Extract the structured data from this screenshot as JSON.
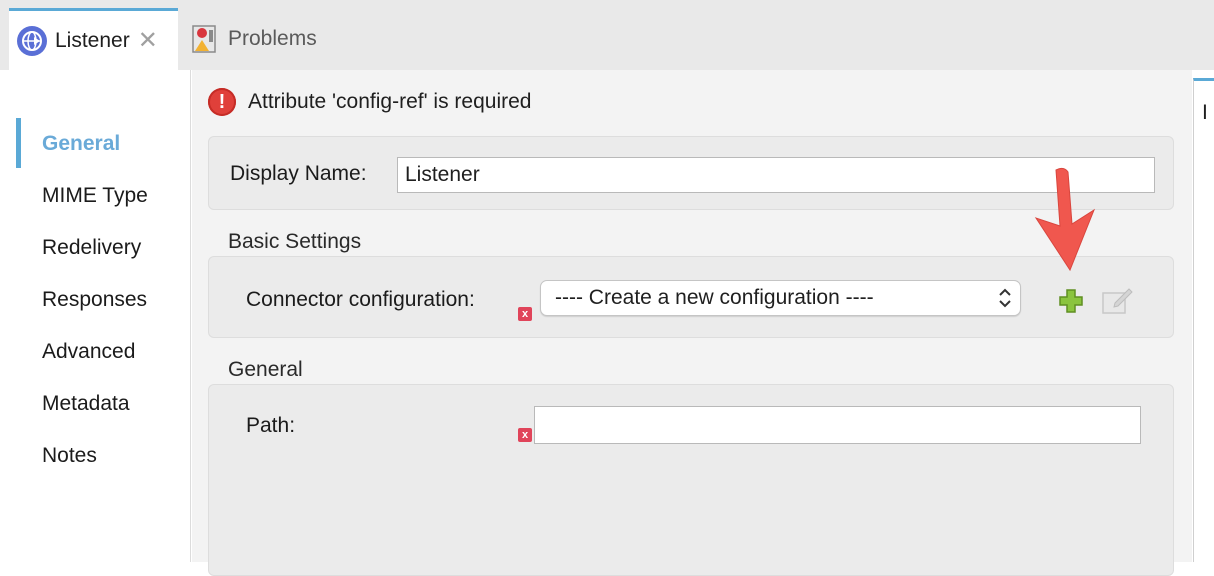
{
  "tabs": [
    {
      "label": "Listener",
      "icon": "globe-connector-icon",
      "close_glyph": "✕"
    },
    {
      "label": "Problems",
      "icon": "problems-view-icon"
    }
  ],
  "sidebar": {
    "items": [
      {
        "label": "General",
        "selected": true
      },
      {
        "label": "MIME Type"
      },
      {
        "label": "Redelivery"
      },
      {
        "label": "Responses"
      },
      {
        "label": "Advanced"
      },
      {
        "label": "Metadata"
      },
      {
        "label": "Notes"
      }
    ]
  },
  "error": {
    "message": "Attribute 'config-ref' is required",
    "glyph": "!"
  },
  "display_name": {
    "label": "Display Name:",
    "value": "Listener"
  },
  "basic_settings": {
    "title": "Basic Settings",
    "connector_label": "Connector configuration:",
    "connector_value": "---- Create a new configuration ----",
    "required_glyph": "x"
  },
  "general": {
    "title": "General",
    "path_label": "Path:",
    "path_value": ""
  },
  "right_pane": {
    "text": "I"
  },
  "colors": {
    "accent": "#5aa9d6",
    "error": "#e0403a",
    "arrow": "#f0574e",
    "add": "#8bc43f"
  }
}
